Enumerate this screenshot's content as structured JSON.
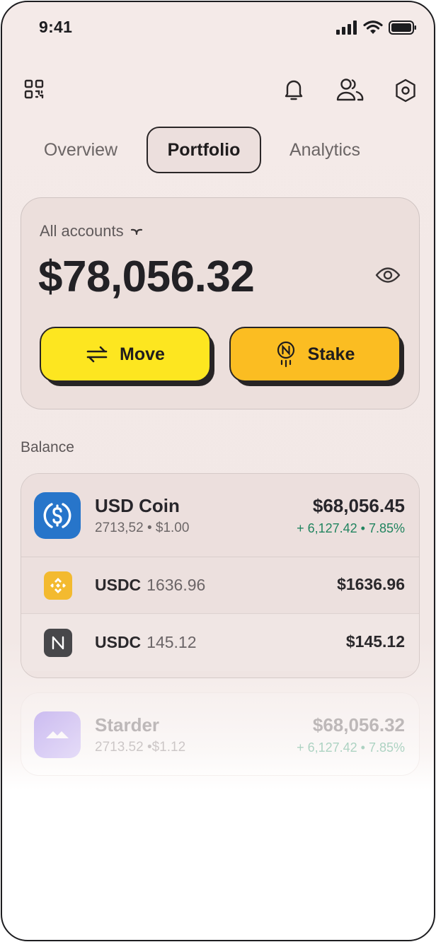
{
  "status_bar": {
    "time": "9:41"
  },
  "header": {
    "qr_icon": "qr-code-icon",
    "bell_icon": "bell-icon",
    "users_icon": "users-icon",
    "settings_icon": "hexagon-settings-icon"
  },
  "tabs": [
    {
      "label": "Overview",
      "active": false
    },
    {
      "label": "Portfolio",
      "active": true
    },
    {
      "label": "Analytics",
      "active": false
    }
  ],
  "summary": {
    "account_selector": "All accounts",
    "total_balance": "$78,056.32",
    "move_label": "Move",
    "stake_label": "Stake"
  },
  "balance": {
    "section_label": "Balance",
    "main": {
      "name": "USD Coin",
      "meta": "2713,52 • $1.00",
      "amount": "$68,056.45",
      "change": "+ 6,127.42 • 7.85%"
    },
    "sub": [
      {
        "symbol": "USDC",
        "quantity": "1636.96",
        "amount": "$1636.96",
        "logo_color": "#f3ba2f"
      },
      {
        "symbol": "USDC",
        "quantity": "145.12",
        "amount": "$145.12",
        "logo_color": "#47474a"
      }
    ]
  },
  "other": {
    "name": "Starder",
    "meta": "2713.52 •$1.12",
    "amount": "$68,056.32",
    "change": "+ 6,127.42 • 7.85%"
  },
  "colors": {
    "accent_yellow": "#fde620",
    "accent_orange": "#fbbd22",
    "positive": "#21845f",
    "usdc_blue": "#2775ca"
  }
}
